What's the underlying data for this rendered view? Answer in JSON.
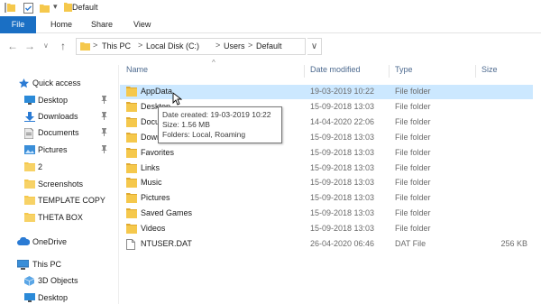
{
  "window": {
    "title": "Default",
    "qat_dropdown_glyph": "▾"
  },
  "ribbon": {
    "tabs": [
      "File",
      "Home",
      "Share",
      "View"
    ]
  },
  "address": {
    "back": "←",
    "forward": "→",
    "recent": "∨",
    "up": "↑",
    "crumbs": [
      "This PC",
      "Local Disk (C:)",
      "Users",
      "Default"
    ],
    "separator": ">",
    "refresh": "∨"
  },
  "sidebar": {
    "items": [
      {
        "label": "Quick access",
        "icon": "star-icon",
        "pinned": false
      },
      {
        "label": "Desktop",
        "icon": "desktop-icon",
        "pinned": true
      },
      {
        "label": "Downloads",
        "icon": "download-icon",
        "pinned": true
      },
      {
        "label": "Documents",
        "icon": "document-icon",
        "pinned": true
      },
      {
        "label": "Pictures",
        "icon": "pictures-icon",
        "pinned": true
      },
      {
        "label": "2",
        "icon": "folder-icon",
        "pinned": false
      },
      {
        "label": "Screenshots",
        "icon": "folder-icon",
        "pinned": false
      },
      {
        "label": "TEMPLATE COPY",
        "icon": "folder-icon",
        "pinned": false
      },
      {
        "label": "THETA BOX",
        "icon": "folder-icon",
        "pinned": false
      },
      {
        "label": "OneDrive",
        "icon": "cloud-icon",
        "pinned": false
      },
      {
        "label": "This PC",
        "icon": "computer-icon",
        "pinned": false
      },
      {
        "label": "3D Objects",
        "icon": "cube-icon",
        "pinned": false
      },
      {
        "label": "Desktop",
        "icon": "desktop-icon",
        "pinned": false
      }
    ],
    "pin_glyph": "📌"
  },
  "columns": {
    "name": "Name",
    "date": "Date modified",
    "type": "Type",
    "size": "Size",
    "sort_glyph": "^"
  },
  "files": [
    {
      "name": "AppData",
      "date": "19-03-2019 10:22",
      "type": "File folder",
      "size": "",
      "kind": "folder",
      "state": "selected"
    },
    {
      "name": "Desktop",
      "date": "15-09-2018 13:03",
      "type": "File folder",
      "size": "",
      "kind": "folder",
      "state": ""
    },
    {
      "name": "Documents",
      "date": "14-04-2020 22:06",
      "type": "File folder",
      "size": "",
      "kind": "folder",
      "state": ""
    },
    {
      "name": "Downloads",
      "date": "15-09-2018 13:03",
      "type": "File folder",
      "size": "",
      "kind": "folder",
      "state": ""
    },
    {
      "name": "Favorites",
      "date": "15-09-2018 13:03",
      "type": "File folder",
      "size": "",
      "kind": "folder",
      "state": ""
    },
    {
      "name": "Links",
      "date": "15-09-2018 13:03",
      "type": "File folder",
      "size": "",
      "kind": "folder",
      "state": ""
    },
    {
      "name": "Music",
      "date": "15-09-2018 13:03",
      "type": "File folder",
      "size": "",
      "kind": "folder",
      "state": ""
    },
    {
      "name": "Pictures",
      "date": "15-09-2018 13:03",
      "type": "File folder",
      "size": "",
      "kind": "folder",
      "state": ""
    },
    {
      "name": "Saved Games",
      "date": "15-09-2018 13:03",
      "type": "File folder",
      "size": "",
      "kind": "folder",
      "state": ""
    },
    {
      "name": "Videos",
      "date": "15-09-2018 13:03",
      "type": "File folder",
      "size": "",
      "kind": "folder",
      "state": ""
    },
    {
      "name": "NTUSER.DAT",
      "date": "26-04-2020 06:46",
      "type": "DAT File",
      "size": "256 KB",
      "kind": "file",
      "state": ""
    }
  ],
  "tooltip": {
    "lines": [
      "Date created: 19-03-2019 10:22",
      "Size: 1.56 MB",
      "Folders: Local, Roaming"
    ]
  },
  "colors": {
    "file_tab": "#1a6fc4",
    "selection": "#cce8ff",
    "folder": "#f5c84c",
    "folder_dark": "#e0a930",
    "header_text": "#4d6a8f"
  }
}
